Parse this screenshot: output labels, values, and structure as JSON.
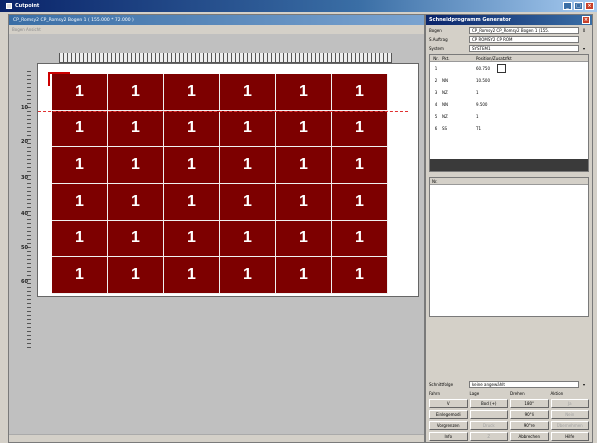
{
  "window": {
    "title": "Cutpoint"
  },
  "document": {
    "subtitle": "CP_Romsy2 CP_Romsy2 Bogen 1  ( 155.000 * 72.000 )",
    "menu": "Bogen   Ansicht"
  },
  "ruler": {
    "ticks": [
      "10",
      "20",
      "30",
      "40",
      "50",
      "60"
    ]
  },
  "sheet": {
    "cell_label": "1",
    "rows": 6,
    "cols": 6
  },
  "generator": {
    "title": "Schneidprogramm Generator",
    "fields": [
      {
        "label": "Bogen",
        "value": "CP_Romsy2 CP_Romsy2 Bogen 1 (155.",
        "extra": "0"
      },
      {
        "label": "S.Auftrag",
        "value": "CP ROMSY2 CP ROM",
        "extra": ""
      },
      {
        "label": "System",
        "value": "SYSTEM1",
        "extra": ""
      }
    ],
    "columns": [
      "Nr.",
      "Pkt.",
      "Position/Zusatzfkt"
    ],
    "rows": [
      {
        "nr": "1",
        "bz": "",
        "pos": "60.750"
      },
      {
        "nr": "2",
        "bz": "NN",
        "pos": "10.500"
      },
      {
        "nr": "3",
        "bz": "NZ",
        "pos": "1"
      },
      {
        "nr": "4",
        "bz": "NN",
        "pos": "9.500"
      },
      {
        "nr": "5",
        "bz": "NZ",
        "pos": "1"
      },
      {
        "nr": "6",
        "bz": "SS",
        "pos": "T1"
      }
    ],
    "info_header": "Nr.",
    "mode": {
      "label": "Schnittfolge",
      "value": "keine angewählt"
    },
    "groups": [
      {
        "title": "Fahrn",
        "buttons": [
          {
            "label": "V",
            "disabled": false
          },
          {
            "label": "Einlegemodi",
            "disabled": false
          },
          {
            "label": "Vorgrenzen",
            "disabled": false
          },
          {
            "label": "Info",
            "disabled": false
          }
        ]
      },
      {
        "title": "Lage",
        "buttons": [
          {
            "label": "Bod (+)",
            "disabled": false
          },
          {
            "label": "",
            "disabled": true
          },
          {
            "label": "Druck",
            "disabled": true
          },
          {
            "label": "Z",
            "disabled": true
          }
        ]
      },
      {
        "title": "Drehen",
        "buttons": [
          {
            "label": "180°",
            "disabled": false
          },
          {
            "label": "90°li",
            "disabled": false
          },
          {
            "label": "90°re",
            "disabled": false
          },
          {
            "label": "Abbrechen",
            "disabled": false
          }
        ]
      },
      {
        "title": "Aktion",
        "buttons": [
          {
            "label": "Ja",
            "disabled": true
          },
          {
            "label": "Nein",
            "disabled": true
          },
          {
            "label": "Übernehmen",
            "disabled": true
          },
          {
            "label": "Hilfe",
            "disabled": false
          }
        ]
      }
    ]
  }
}
